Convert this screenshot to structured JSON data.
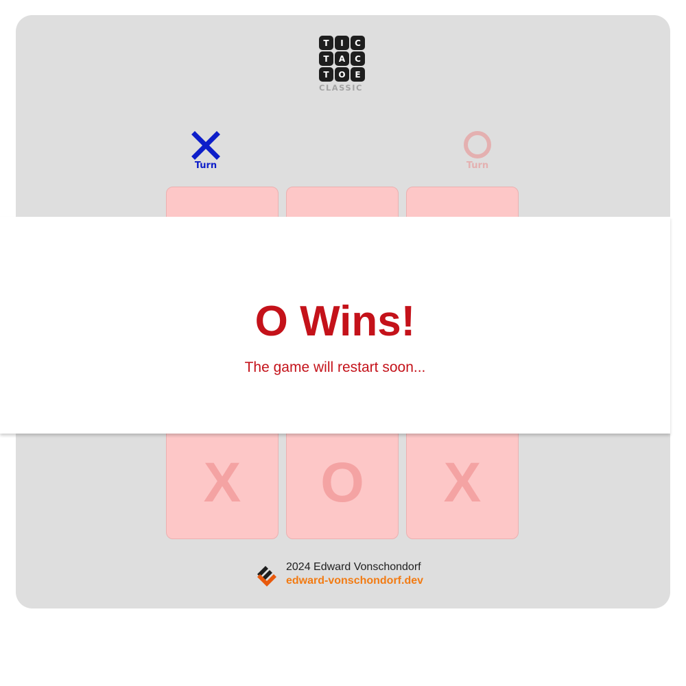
{
  "logo": {
    "letters": [
      "T",
      "I",
      "C",
      "T",
      "A",
      "C",
      "T",
      "O",
      "E"
    ],
    "subtitle": "CLASSIC"
  },
  "players": {
    "x": {
      "icon": "x-mark-icon",
      "turn_label": "Turn",
      "color": "#0d1ec9",
      "active": true
    },
    "o": {
      "icon": "o-mark-icon",
      "turn_label": "Turn",
      "color": "#e4b0b0",
      "active": false
    }
  },
  "board": {
    "tiles": [
      "",
      "",
      "",
      "",
      "",
      "",
      "X",
      "O",
      "X"
    ],
    "tile_color": "#fdc7c7",
    "mark_color": "#f4a3a3"
  },
  "result": {
    "title": "O Wins!",
    "message": "The game will restart soon...",
    "color": "#c4121a"
  },
  "footer": {
    "copyright": "2024 Edward Vonschondorf",
    "link": "edward-vonschondorf.dev",
    "link_color": "#f27b13",
    "icon": "brand-logo-icon"
  }
}
